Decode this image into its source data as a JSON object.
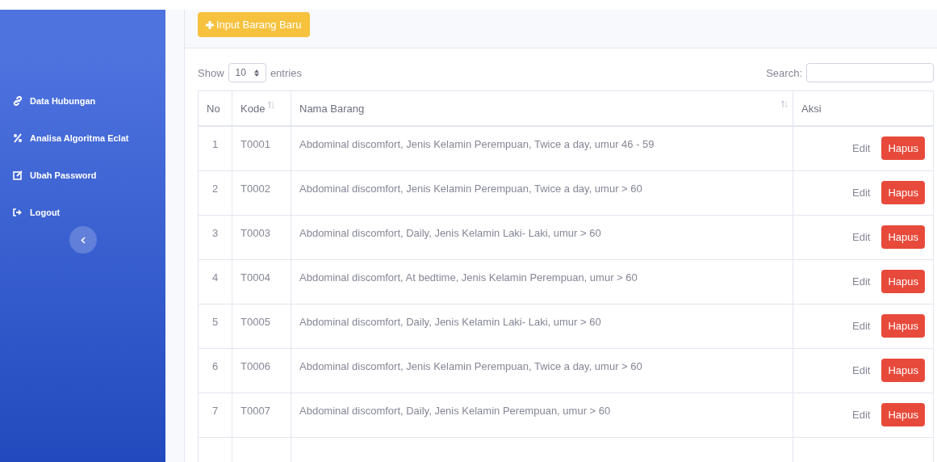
{
  "sidebar": {
    "items": [
      {
        "label": "Data Hubungan"
      },
      {
        "label": "Analisa Algoritma Eclat"
      },
      {
        "label": "Ubah Password"
      },
      {
        "label": "Logout"
      }
    ]
  },
  "card": {
    "add_button": "Input Barang Baru",
    "length": {
      "prefix": "Show",
      "value": "10",
      "suffix": "entries"
    },
    "search": {
      "label": "Search:"
    },
    "table": {
      "columns": [
        {
          "label": "No",
          "sortable": false
        },
        {
          "label": "Kode",
          "sortable": true
        },
        {
          "label": "Nama Barang",
          "sortable": true
        },
        {
          "label": "Aksi",
          "sortable": false
        }
      ],
      "rows": [
        {
          "no": "1",
          "kode": "T0001",
          "nama": "Abdominal discomfort, Jenis Kelamin Perempuan, Twice a day, umur 46 - 59",
          "edit": "Edit",
          "delete": "Hapus"
        },
        {
          "no": "2",
          "kode": "T0002",
          "nama": "Abdominal discomfort, Jenis Kelamin Perempuan, Twice a day, umur > 60",
          "edit": "Edit",
          "delete": "Hapus"
        },
        {
          "no": "3",
          "kode": "T0003",
          "nama": "Abdominal discomfort, Daily, Jenis Kelamin Laki- Laki, umur > 60",
          "edit": "Edit",
          "delete": "Hapus"
        },
        {
          "no": "4",
          "kode": "T0004",
          "nama": "Abdominal discomfort, At bedtime, Jenis Kelamin Perempuan, umur > 60",
          "edit": "Edit",
          "delete": "Hapus"
        },
        {
          "no": "5",
          "kode": "T0005",
          "nama": "Abdominal discomfort, Daily, Jenis Kelamin Laki- Laki, umur > 60",
          "edit": "Edit",
          "delete": "Hapus"
        },
        {
          "no": "6",
          "kode": "T0006",
          "nama": "Abdominal discomfort, Jenis Kelamin Perempuan, Twice a day, umur > 60",
          "edit": "Edit",
          "delete": "Hapus"
        },
        {
          "no": "7",
          "kode": "T0007",
          "nama": "Abdominal discomfort, Daily, Jenis Kelamin Perempuan, umur > 60",
          "edit": "Edit",
          "delete": "Hapus"
        }
      ]
    }
  }
}
